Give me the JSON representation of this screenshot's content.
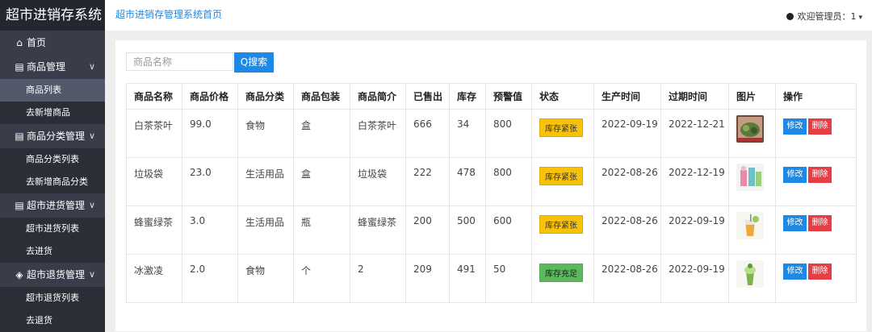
{
  "app": {
    "title": "超市进销存系统"
  },
  "sidebar": {
    "items": [
      {
        "label": "首页",
        "icon": "home-icon"
      },
      {
        "label": "商品管理",
        "icon": "doc-icon",
        "children": [
          "商品列表",
          "去新增商品"
        ]
      },
      {
        "label": "商品分类管理",
        "icon": "doc-icon",
        "children": [
          "商品分类列表",
          "去新增商品分类"
        ]
      },
      {
        "label": "超市进货管理",
        "icon": "doc-icon",
        "children": [
          "超市进货列表",
          "去进货"
        ]
      },
      {
        "label": "超市退货管理",
        "icon": "box-icon",
        "children": [
          "超市退货列表",
          "去退货"
        ]
      }
    ],
    "active": "商品列表"
  },
  "header": {
    "breadcrumb": "超市进销存管理系统首页",
    "user": "欢迎管理员：1"
  },
  "search": {
    "placeholder": "商品名称",
    "button": "Q搜索"
  },
  "table": {
    "headers": [
      "商品名称",
      "商品价格",
      "商品分类",
      "商品包装",
      "商品简介",
      "已售出",
      "库存",
      "预警值",
      "状态",
      "生产时间",
      "过期时间",
      "图片",
      "操作"
    ],
    "rows": [
      {
        "name": "白茶茶叶",
        "price": "99.0",
        "category": "食物",
        "pack": "盒",
        "desc": "白茶茶叶",
        "sold": "666",
        "stock": "34",
        "warn": "800",
        "status": "库存紧张",
        "status_type": "warn",
        "produced": "2022-09-19",
        "expires": "2022-12-21",
        "image": "tea-image"
      },
      {
        "name": "垃圾袋",
        "price": "23.0",
        "category": "生活用品",
        "pack": "盒",
        "desc": "垃圾袋",
        "sold": "222",
        "stock": "478",
        "warn": "800",
        "status": "库存紧张",
        "status_type": "warn",
        "produced": "2022-08-26",
        "expires": "2022-12-19",
        "image": "bag-image"
      },
      {
        "name": "蜂蜜绿茶",
        "price": "3.0",
        "category": "生活用品",
        "pack": "瓶",
        "desc": "蜂蜜绿茶",
        "sold": "200",
        "stock": "500",
        "warn": "600",
        "status": "库存紧张",
        "status_type": "warn",
        "produced": "2022-08-26",
        "expires": "2022-09-19",
        "image": "drink-image"
      },
      {
        "name": "冰激凌",
        "price": "2.0",
        "category": "食物",
        "pack": "个",
        "desc": "2",
        "sold": "209",
        "stock": "491",
        "warn": "50",
        "status": "库存充足",
        "status_type": "ok",
        "produced": "2022-08-26",
        "expires": "2022-09-19",
        "image": "icecream-image"
      }
    ],
    "actions": {
      "edit": "修改",
      "delete": "删除"
    }
  },
  "colors": {
    "primary": "#1e88e5",
    "danger": "#e53e45",
    "warning": "#f9c20a",
    "success": "#5cb85c",
    "sidebar": "#393d49"
  }
}
